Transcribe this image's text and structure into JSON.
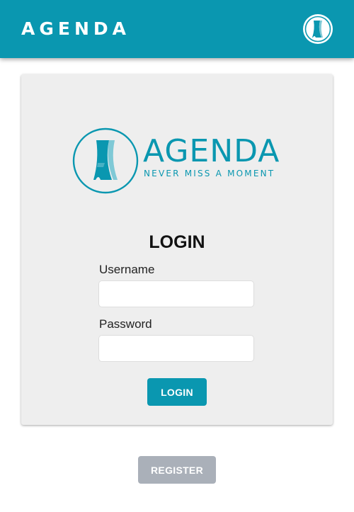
{
  "header": {
    "title": "AGENDA",
    "logo_icon": "agenda-logo-icon"
  },
  "brand": {
    "name": "AGENDA",
    "tagline": "NEVER MISS A MOMENT",
    "logo_icon": "agenda-logo-icon"
  },
  "login": {
    "title": "LOGIN",
    "username_label": "Username",
    "username_value": "",
    "password_label": "Password",
    "password_value": "",
    "submit_label": "LOGIN"
  },
  "register": {
    "label": "REGISTER"
  },
  "colors": {
    "accent": "#0a97b0",
    "card_background": "#eeeeee",
    "register_button": "#aab0b9"
  }
}
